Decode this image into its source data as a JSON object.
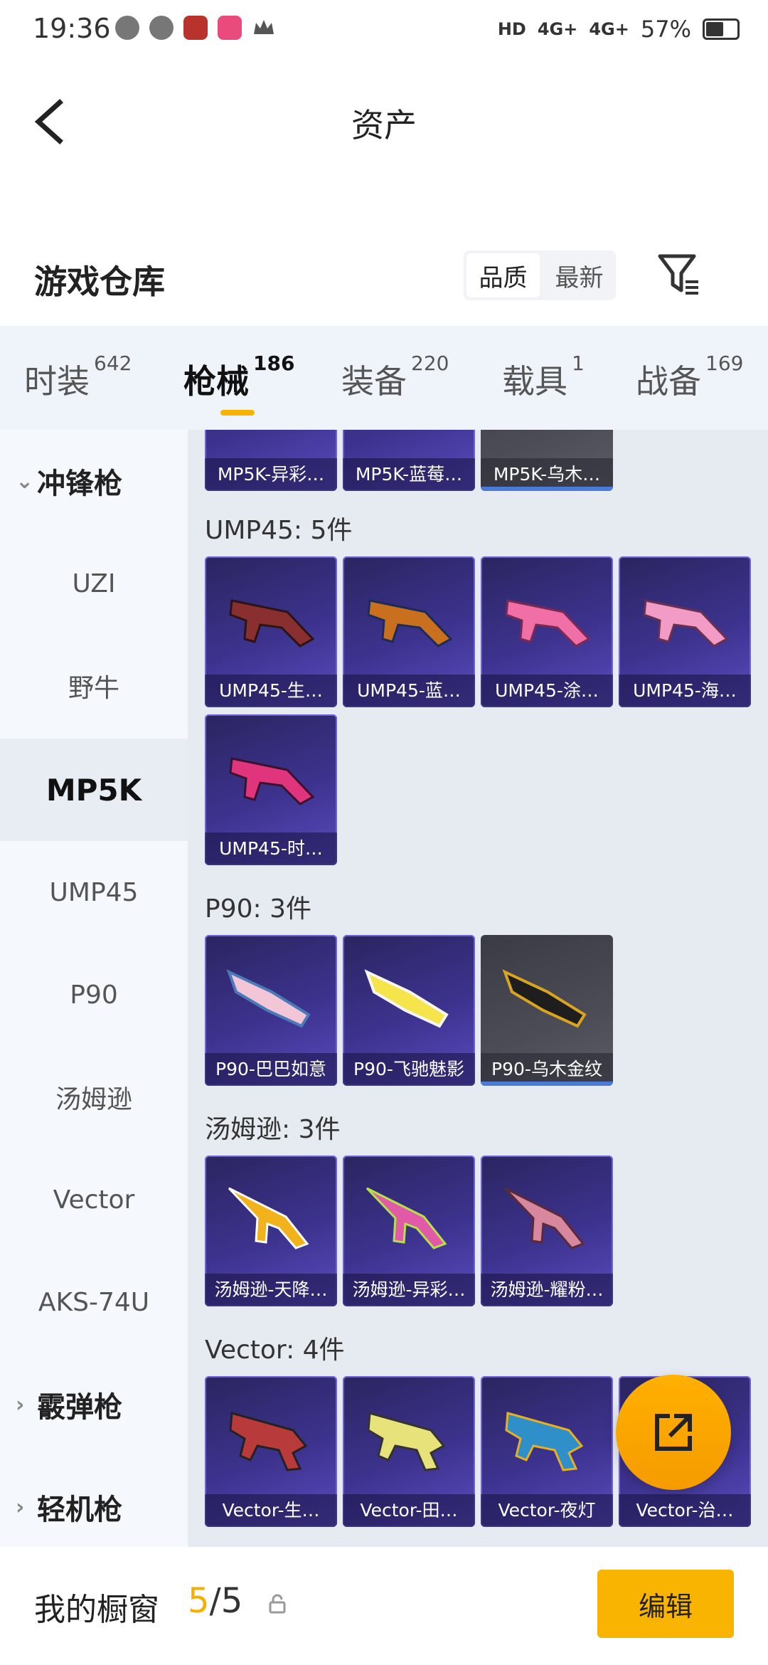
{
  "status_bar": {
    "time": "19:36",
    "network": [
      "HD",
      "4G+",
      "4G+"
    ],
    "battery": "57%"
  },
  "header": {
    "title": "资产"
  },
  "warehouse": {
    "title": "游戏仓库",
    "sort_options": [
      "品质",
      "最新"
    ],
    "selected_sort": "品质"
  },
  "tabs": [
    {
      "label": "时装",
      "count": "642"
    },
    {
      "label": "枪械",
      "count": "186",
      "active": true
    },
    {
      "label": "装备",
      "count": "220"
    },
    {
      "label": "载具",
      "count": "1"
    },
    {
      "label": "战备",
      "count": "169"
    }
  ],
  "sidebar": {
    "categories": [
      {
        "label": "冲锋枪",
        "expanded": true
      },
      {
        "label": "霰弹枪"
      },
      {
        "label": "轻机枪"
      }
    ],
    "items": [
      "UZI",
      "野牛",
      "MP5K",
      "UMP45",
      "P90",
      "汤姆逊",
      "Vector",
      "AKS-74U"
    ],
    "selected": "MP5K"
  },
  "groups": [
    {
      "title": "",
      "items": [
        "MP5K-异彩…",
        "MP5K-蓝莓…",
        "MP5K-乌木…"
      ]
    },
    {
      "title": "UMP45: 5件",
      "items": [
        "UMP45-生…",
        "UMP45-蓝…",
        "UMP45-涂…",
        "UMP45-海…",
        "UMP45-时…"
      ]
    },
    {
      "title": "P90: 3件",
      "items": [
        "P90-巴巴如意",
        "P90-飞驰魅影",
        "P90-乌木金纹"
      ]
    },
    {
      "title": "汤姆逊: 3件",
      "items": [
        "汤姆逊-天降…",
        "汤姆逊-异彩…",
        "汤姆逊-耀粉…"
      ]
    },
    {
      "title": "Vector: 4件",
      "items": [
        "Vector-生…",
        "Vector-田…",
        "Vector-夜灯",
        "Vector-治…"
      ]
    }
  ],
  "bottom_bar": {
    "label": "我的橱窗",
    "count_current": "5",
    "count_total": "/5",
    "edit_label": "编辑"
  },
  "colors": {
    "accent": "#f8b400",
    "card_purple": "#3d338f",
    "card_grey": "#4b4c56"
  },
  "icons": [
    "back-icon",
    "filter-icon",
    "share-icon",
    "lock-icon",
    "chevron-down-icon",
    "chevron-right-icon"
  ]
}
